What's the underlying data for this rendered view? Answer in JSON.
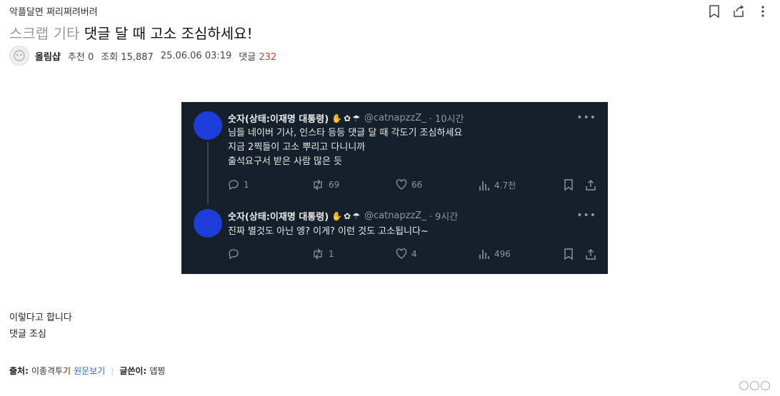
{
  "board": {
    "category": "악플달면 쩌리쩌려버려"
  },
  "post": {
    "category_1": "스크랩",
    "category_2": "기타",
    "title": "댓글 달 때 고소 조심하세요!",
    "author": "올림샵",
    "recommend_label": "추천",
    "recommend_count": "0",
    "views_label": "조회",
    "views_count": "15,887",
    "datetime": "25.06.06 03:19",
    "comments_label": "댓글",
    "comments_count": "232",
    "body_lines": [
      "이렇다고 합니다",
      "댓글 조심"
    ]
  },
  "tweets": [
    {
      "name": "숫자(상태:이재명 대통령)",
      "handle": "@catnapzzZ_",
      "time": "· 10시간",
      "text_lines": [
        "님들 네이버 기사, 인스타 등등 댓글 달 때 각도기 조심하세요",
        "지금 2찍들이 고소 뿌리고 다니니까",
        "출석요구서 받은 사람 많은 듯"
      ],
      "replies": "1",
      "retweets": "69",
      "likes": "66",
      "views": "4.7천"
    },
    {
      "name": "숫자(상태:이재명 대통령)",
      "handle": "@catnapzzZ_",
      "time": "· 9시간",
      "text_lines": [
        "진짜 별것도 아닌 엥? 이게? 이런 것도 고소됩니다~"
      ],
      "replies": "",
      "retweets": "1",
      "likes": "4",
      "views": "496"
    }
  ],
  "footer": {
    "source_label": "출처:",
    "source_name": "이종격투기",
    "source_link": "원문보기",
    "writer_label": "글쓴이:",
    "writer_name": "뎁찡"
  },
  "icons": [
    "bookmark-icon",
    "share-icon",
    "avatar-icon",
    "more-icon",
    "reply-icon",
    "retweet-icon",
    "like-icon",
    "views-icon",
    "tweet-bookmark-icon",
    "tweet-share-icon",
    "cc-license-icon"
  ],
  "colors": {
    "tweet_bg": "#15202b",
    "tweet_avatar": "#1d3ddb",
    "comment_count": "#e53935",
    "link": "#2a6ebb"
  }
}
